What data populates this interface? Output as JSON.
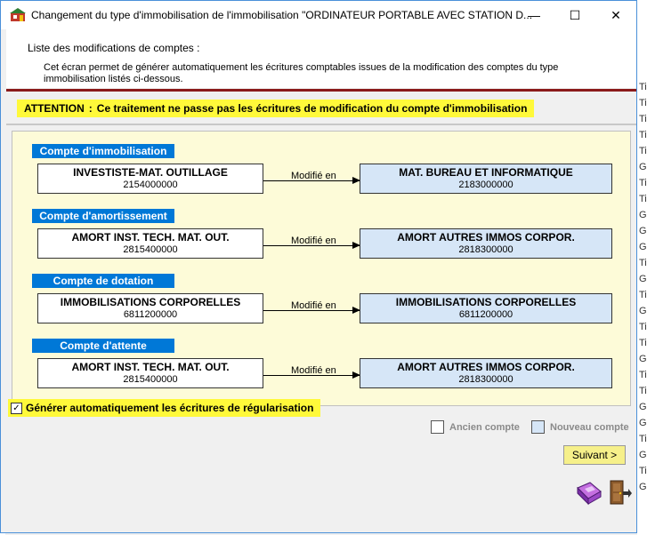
{
  "window": {
    "title": "Changement du type d'immobilisation de l'immobilisation \"ORDINATEUR PORTABLE AVEC STATION D...",
    "controls": {
      "minimize": "—",
      "maximize": "☐",
      "close": "✕"
    }
  },
  "header": {
    "title": "Liste des modifications de comptes :",
    "description": "Cet écran permet de générer automatiquement les écritures comptables issues de la modification des comptes du type immobilisation listés ci-dessous."
  },
  "attention": {
    "label": "ATTENTION",
    "separator": ":",
    "message": "Ce traitement ne passe pas les écritures de modification du compte d'immobilisation"
  },
  "sections": [
    {
      "label": "Compte d'immobilisation",
      "old_name": "INVESTISTE-MAT. OUTILLAGE",
      "old_number": "2154000000",
      "arrow_label": "Modifié en",
      "new_name": "MAT. BUREAU ET INFORMATIQUE",
      "new_number": "2183000000"
    },
    {
      "label": "Compte d'amortissement",
      "old_name": "AMORT INST. TECH. MAT. OUT.",
      "old_number": "2815400000",
      "arrow_label": "Modifié en",
      "new_name": "AMORT AUTRES IMMOS CORPOR.",
      "new_number": "2818300000"
    },
    {
      "label": "Compte de dotation",
      "old_name": "IMMOBILISATIONS CORPORELLES",
      "old_number": "6811200000",
      "arrow_label": "Modifié en",
      "new_name": "IMMOBILISATIONS CORPORELLES",
      "new_number": "6811200000"
    },
    {
      "label": "Compte d'attente",
      "old_name": "AMORT INST. TECH. MAT. OUT.",
      "old_number": "2815400000",
      "arrow_label": "Modifié en",
      "new_name": "AMORT AUTRES IMMOS CORPOR.",
      "new_number": "2818300000"
    }
  ],
  "generate_checkbox": {
    "label": "Générer automatiquement les écritures de régularisation",
    "checked": true,
    "mark": "✓"
  },
  "legend": {
    "old_label": "Ancien compte",
    "new_label": "Nouveau compte",
    "old_color": "#ffffff",
    "new_color": "#d6e6f7"
  },
  "buttons": {
    "next": "Suivant >"
  },
  "colors": {
    "accent": "#0078d7",
    "highlight": "#fff93a",
    "panel_bg": "#fdfbd8",
    "separator_red": "#8b1a1a"
  },
  "background_fragments": [
    "Ti",
    "Ti",
    "Ti",
    "Ti",
    "Ti",
    "G",
    "Ti",
    "Ti",
    "G",
    "G",
    "G",
    "Ti",
    "G",
    "Ti",
    "G",
    "Ti",
    "Ti",
    "G",
    "Ti",
    "Ti",
    "G",
    "G",
    "Ti",
    "G",
    "Ti",
    "G"
  ]
}
